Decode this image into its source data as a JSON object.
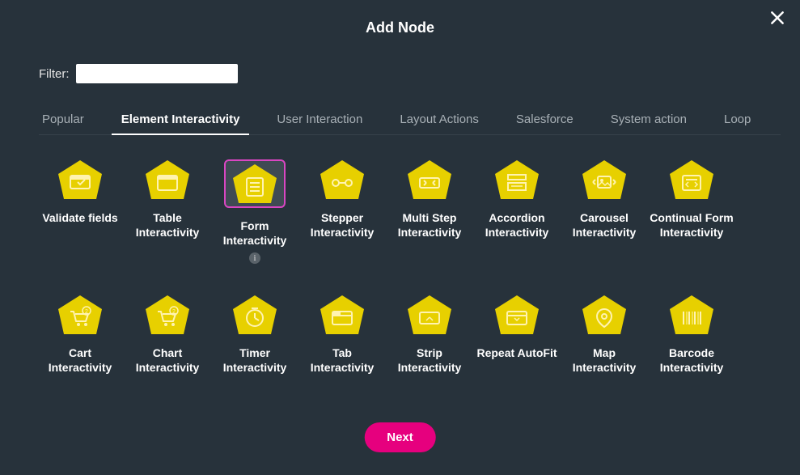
{
  "header": {
    "title": "Add Node",
    "filter_label": "Filter:",
    "filter_value": ""
  },
  "tabs": [
    {
      "label": "Popular",
      "active": false
    },
    {
      "label": "Element Interactivity",
      "active": true
    },
    {
      "label": "User Interaction",
      "active": false
    },
    {
      "label": "Layout Actions",
      "active": false
    },
    {
      "label": "Salesforce",
      "active": false
    },
    {
      "label": "System action",
      "active": false
    },
    {
      "label": "Loop",
      "active": false
    }
  ],
  "nodes": [
    {
      "label": "Validate fields",
      "icon": "validate-icon",
      "selected": false,
      "info": false
    },
    {
      "label": "Table Interactivity",
      "icon": "table-icon",
      "selected": false,
      "info": false
    },
    {
      "label": "Form Interactivity",
      "icon": "form-icon",
      "selected": true,
      "info": true
    },
    {
      "label": "Stepper Interactivity",
      "icon": "stepper-icon",
      "selected": false,
      "info": false
    },
    {
      "label": "Multi Step Interactivity",
      "icon": "multistep-icon",
      "selected": false,
      "info": false
    },
    {
      "label": "Accordion Interactivity",
      "icon": "accordion-icon",
      "selected": false,
      "info": false
    },
    {
      "label": "Carousel Interactivity",
      "icon": "carousel-icon",
      "selected": false,
      "info": false
    },
    {
      "label": "Continual Form Interactivity",
      "icon": "continualform-icon",
      "selected": false,
      "info": false
    },
    {
      "label": "Cart Interactivity",
      "icon": "cart-icon",
      "selected": false,
      "info": false
    },
    {
      "label": "Chart Interactivity",
      "icon": "chart-icon",
      "selected": false,
      "info": false
    },
    {
      "label": "Timer Interactivity",
      "icon": "timer-icon",
      "selected": false,
      "info": false
    },
    {
      "label": "Tab Interactivity",
      "icon": "tab-icon",
      "selected": false,
      "info": false
    },
    {
      "label": "Strip Interactivity",
      "icon": "strip-icon",
      "selected": false,
      "info": false
    },
    {
      "label": "Repeat AutoFit",
      "icon": "repeat-icon",
      "selected": false,
      "info": false
    },
    {
      "label": "Map Interactivity",
      "icon": "map-icon",
      "selected": false,
      "info": false
    },
    {
      "label": "Barcode Interactivity",
      "icon": "barcode-icon",
      "selected": false,
      "info": false
    }
  ],
  "footer": {
    "next_label": "Next"
  },
  "palette": {
    "accent": "#e6007e",
    "icon_fill": "#e7d000",
    "icon_stroke": "#fff3b0",
    "bg": "#27323b",
    "select": "#d946c2"
  }
}
